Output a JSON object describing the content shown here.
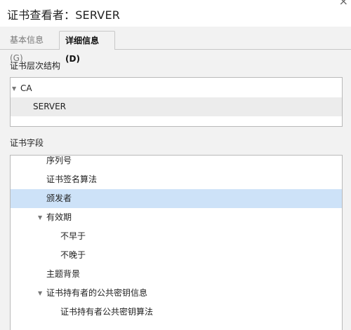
{
  "window": {
    "title": "证书查看者：SERVER"
  },
  "tabs": [
    {
      "label": "基本信息(G)",
      "active": false
    },
    {
      "label": "详细信息(D)",
      "active": true
    }
  ],
  "hierarchy": {
    "label": "证书层次结构",
    "items": [
      {
        "label": "CA",
        "expanded": true
      },
      {
        "label": "SERVER",
        "selected": true
      }
    ]
  },
  "fields": {
    "label": "证书字段",
    "items": [
      {
        "label": "序列号",
        "level": 2,
        "expander": false
      },
      {
        "label": "证书签名算法",
        "level": 2,
        "expander": false
      },
      {
        "label": "颁发者",
        "level": 2,
        "expander": false,
        "selected": true
      },
      {
        "label": "有效期",
        "level": 2,
        "expander": true
      },
      {
        "label": "不早于",
        "level": 3,
        "expander": false
      },
      {
        "label": "不晚于",
        "level": 3,
        "expander": false
      },
      {
        "label": "主题背景",
        "level": 2,
        "expander": false
      },
      {
        "label": "证书持有者的公共密钥信息",
        "level": 2,
        "expander": true
      },
      {
        "label": "证书持有者公共密钥算法",
        "level": 3,
        "expander": false
      }
    ]
  },
  "colors": {
    "selection": "#cde2f8",
    "hierarchy_selection": "#ececec"
  }
}
